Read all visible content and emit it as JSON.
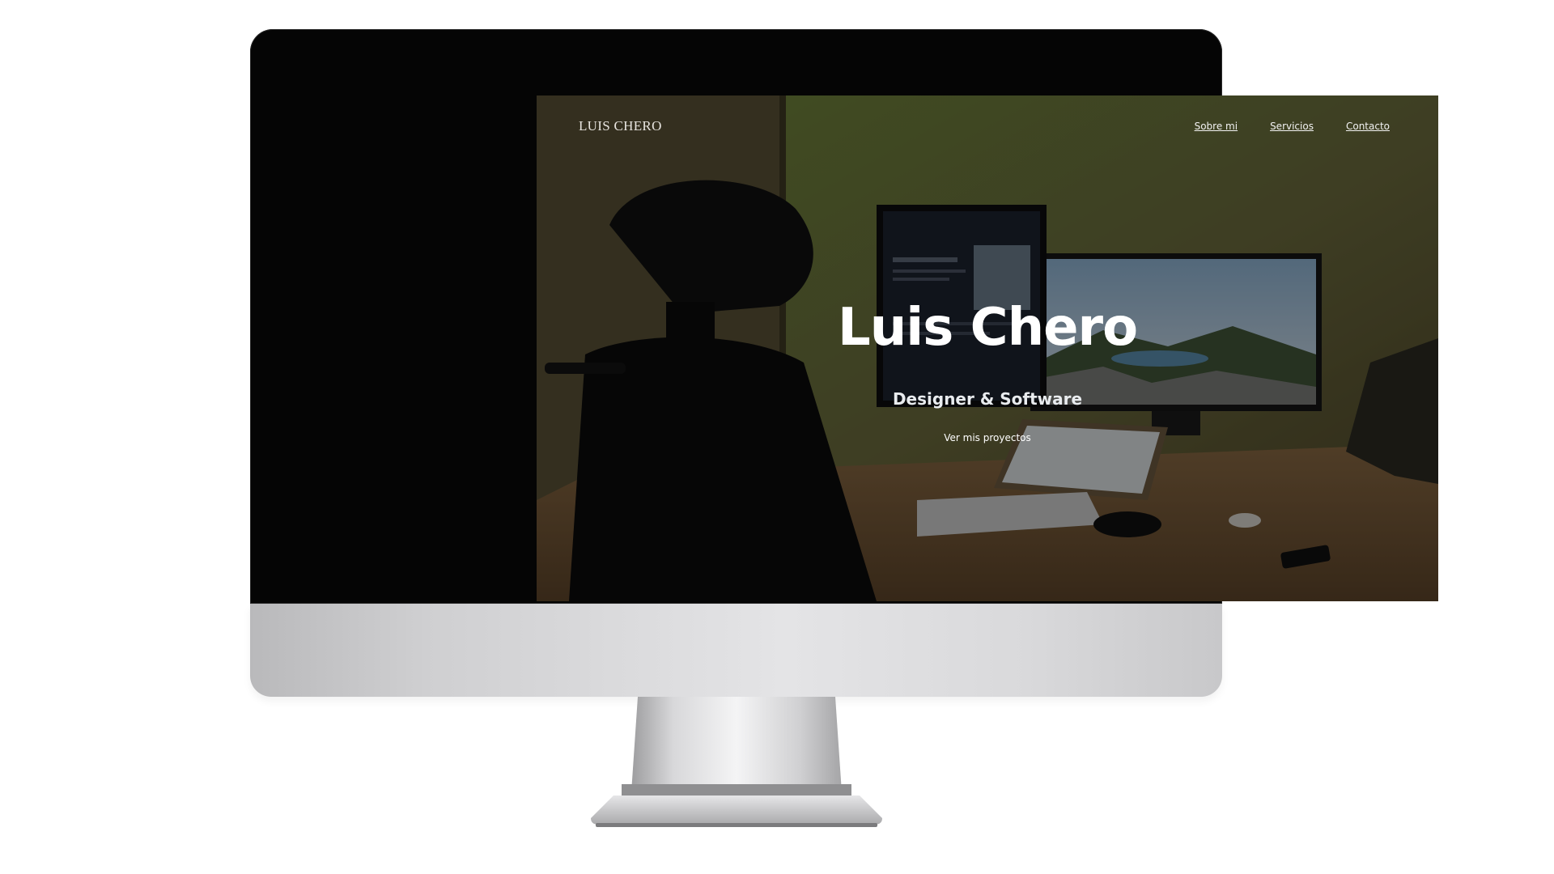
{
  "site": {
    "logo": "LUIS CHERO",
    "nav": [
      {
        "label": "Sobre mi"
      },
      {
        "label": "Servicios"
      },
      {
        "label": "Contacto"
      }
    ]
  },
  "hero": {
    "title": "Luis Chero",
    "subtitle": "Designer & Software",
    "cta": "Ver mis proyectos",
    "background": "desk-workspace-photo"
  },
  "colors": {
    "overlay": "#000000",
    "text": "#ffffff",
    "monitor_bezel": "#050505",
    "monitor_chin": "#d4d4d6"
  }
}
